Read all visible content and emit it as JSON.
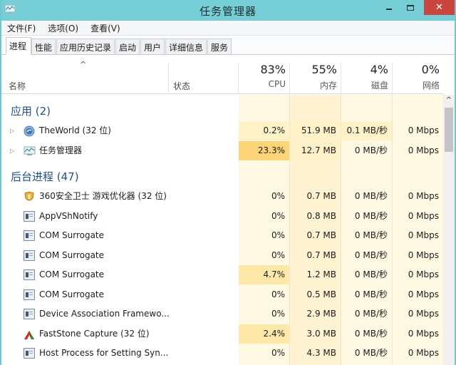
{
  "window": {
    "title": "任务管理器",
    "close_glyph": "✕",
    "accent_color": "#76ced6",
    "close_color": "#c9453d"
  },
  "menu": [
    "文件(F)",
    "选项(O)",
    "查看(V)"
  ],
  "tabs": [
    {
      "label": "进程",
      "active": true
    },
    {
      "label": "性能",
      "active": false
    },
    {
      "label": "应用历史记录",
      "active": false
    },
    {
      "label": "启动",
      "active": false
    },
    {
      "label": "用户",
      "active": false
    },
    {
      "label": "详细信息",
      "active": false
    },
    {
      "label": "服务",
      "active": false
    }
  ],
  "header": {
    "sort_indicator": "^",
    "name_label": "名称",
    "status_label": "状态",
    "cpu": {
      "pct": "83%",
      "label": "CPU"
    },
    "memory": {
      "pct": "55%",
      "label": "内存"
    },
    "disk": {
      "pct": "4%",
      "label": "磁盘"
    },
    "network": {
      "pct": "0%",
      "label": "网络"
    }
  },
  "groups": {
    "apps": {
      "label": "应用 (2)"
    },
    "background": {
      "label": "后台进程 (47)"
    }
  },
  "apps": [
    {
      "name": "TheWorld (32 位)",
      "icon": "theworld-browser-icon",
      "expandable": true,
      "cpu": "0.2%",
      "memory": "51.9 MB",
      "disk": "0.1 MB/秒",
      "network": "0 Mbps"
    },
    {
      "name": "任务管理器",
      "icon": "task-manager-icon",
      "expandable": true,
      "cpu": "23.3%",
      "memory": "12.7 MB",
      "disk": "0 MB/秒",
      "network": "0 Mbps"
    }
  ],
  "background": [
    {
      "name": "360安全卫士 游戏优化器 (32 位)",
      "icon": "360-shield-icon",
      "cpu": "0%",
      "memory": "0.7 MB",
      "disk": "0 MB/秒",
      "network": "0 Mbps"
    },
    {
      "name": "AppVShNotify",
      "icon": "generic-process-icon",
      "cpu": "0%",
      "memory": "0.8 MB",
      "disk": "0 MB/秒",
      "network": "0 Mbps"
    },
    {
      "name": "COM Surrogate",
      "icon": "generic-process-icon",
      "cpu": "0%",
      "memory": "0.7 MB",
      "disk": "0 MB/秒",
      "network": "0 Mbps"
    },
    {
      "name": "COM Surrogate",
      "icon": "generic-process-icon",
      "cpu": "0%",
      "memory": "0.7 MB",
      "disk": "0 MB/秒",
      "network": "0 Mbps"
    },
    {
      "name": "COM Surrogate",
      "icon": "generic-process-icon",
      "cpu": "4.7%",
      "memory": "1.2 MB",
      "disk": "0 MB/秒",
      "network": "0 Mbps"
    },
    {
      "name": "COM Surrogate",
      "icon": "generic-process-icon",
      "cpu": "0%",
      "memory": "0.5 MB",
      "disk": "0 MB/秒",
      "network": "0 Mbps"
    },
    {
      "name": "Device Association Framewo...",
      "icon": "generic-process-icon",
      "cpu": "0%",
      "memory": "2.9 MB",
      "disk": "0 MB/秒",
      "network": "0 Mbps"
    },
    {
      "name": "FastStone Capture (32 位)",
      "icon": "faststone-capture-icon",
      "cpu": "2.4%",
      "memory": "3.0 MB",
      "disk": "0 MB/秒",
      "network": "0 Mbps"
    },
    {
      "name": "Host Process for Setting Syn...",
      "icon": "generic-process-icon",
      "cpu": "0%",
      "memory": "4.3 MB",
      "disk": "0 MB/秒",
      "network": "0 Mbps"
    }
  ],
  "heat_colors": {
    "base": "#fff8e3",
    "light": "#fff1c8",
    "medium": "#fde8a8",
    "strong": "#fbd577"
  }
}
